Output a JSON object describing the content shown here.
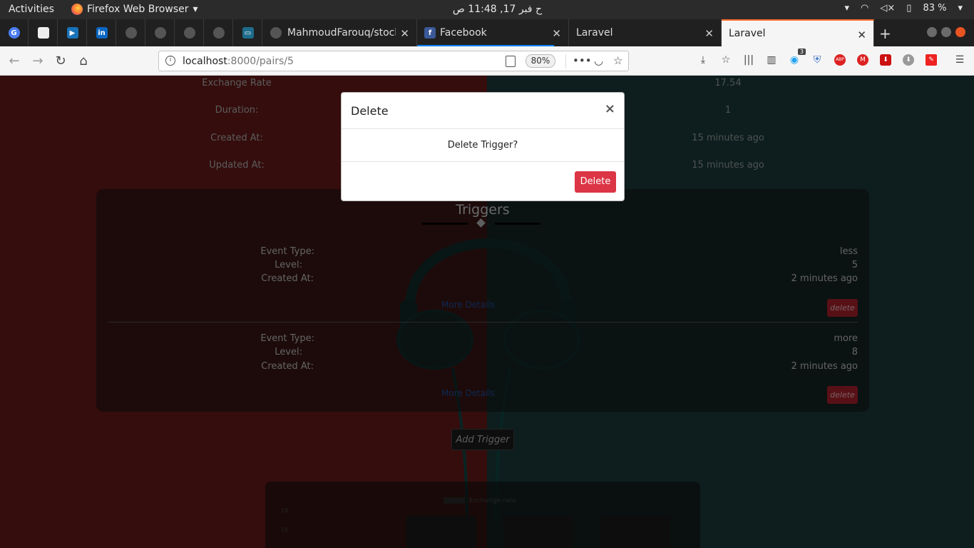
{
  "topbar": {
    "activities": "Activities",
    "app_name": "Firefox Web Browser",
    "clock": "ح فبر 17, 11:48 ص",
    "battery": "83 %"
  },
  "tabs": {
    "pinned_icons": [
      "google-icon",
      "page-icon",
      "media-icon",
      "linkedin-icon",
      "github-icon",
      "github-icon",
      "github-icon",
      "github-icon",
      "scroll-icon"
    ],
    "items": [
      {
        "label": "MahmoudFarouq/stock"
      },
      {
        "label": "Facebook"
      },
      {
        "label": "Laravel"
      },
      {
        "label": "Laravel"
      }
    ]
  },
  "navbar": {
    "url_host": "localhost",
    "url_rest": ":8000/pairs/5",
    "zoom": "80%",
    "addon_badge": "3"
  },
  "pair": {
    "rows": [
      {
        "label": "Exchange Rate",
        "value": "17.54"
      },
      {
        "label": "Duration:",
        "value": "1"
      },
      {
        "label": "Created At:",
        "value": "15 minutes ago"
      },
      {
        "label": "Updated At:",
        "value": "15 minutes ago"
      }
    ]
  },
  "triggers": {
    "title": "Triggers",
    "more_label": "More Details",
    "delete_label": "delete",
    "items": [
      {
        "event_label": "Event Type:",
        "event": "less",
        "level_label": "Level:",
        "level": "5",
        "created_label": "Created At:",
        "created": "2 minutes ago"
      },
      {
        "event_label": "Event Type:",
        "event": "more",
        "level_label": "Level:",
        "level": "8",
        "created_label": "Created At:",
        "created": "2 minutes ago"
      }
    ],
    "add_label": "Add Trigger"
  },
  "chart": {
    "legend": "Exchange-rate",
    "yticks": [
      "18",
      "16"
    ]
  },
  "modal": {
    "title": "Delete",
    "close": "×",
    "body": "Delete Trigger?",
    "confirm": "Delete"
  }
}
